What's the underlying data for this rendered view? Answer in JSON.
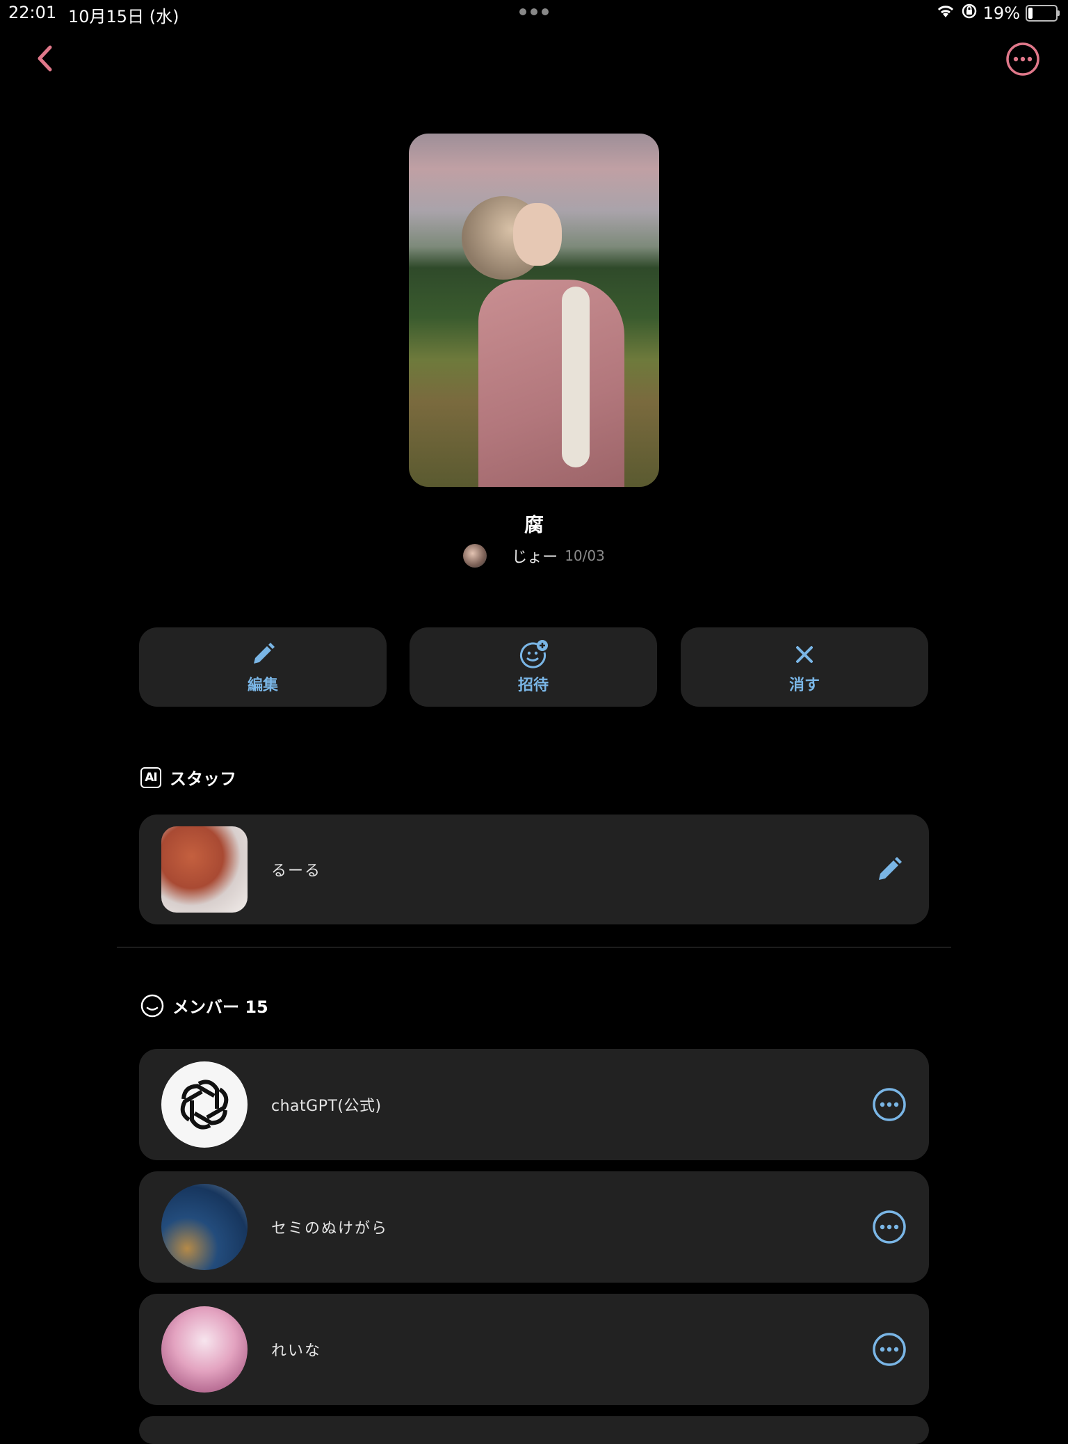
{
  "status_bar": {
    "time": "22:01",
    "date": "10月15日 (水)",
    "battery": "19%",
    "battery_level": 0.19
  },
  "post": {
    "title": "腐",
    "author": "じょー",
    "date": "10/03"
  },
  "actions": {
    "edit": "編集",
    "invite": "招待",
    "delete": "消す"
  },
  "staff_section": {
    "badge": "AI",
    "title": "スタッフ",
    "items": [
      {
        "name": "るーる"
      }
    ]
  },
  "members_section": {
    "title": "メンバー 15",
    "items": [
      {
        "name": "chatGPT(公式)"
      },
      {
        "name": "セミのぬけがら"
      },
      {
        "name": "れいな"
      }
    ]
  },
  "colors": {
    "accent_pink": "#e0788a",
    "accent_blue": "#7ab6e6",
    "card_bg": "#222222",
    "background": "#000000"
  },
  "icons": {
    "back": "chevron-left-icon",
    "more": "ellipsis-circle-icon",
    "edit": "pencil-icon",
    "invite": "add-face-icon",
    "delete": "x-icon",
    "member_menu": "ellipsis-circle-icon"
  }
}
